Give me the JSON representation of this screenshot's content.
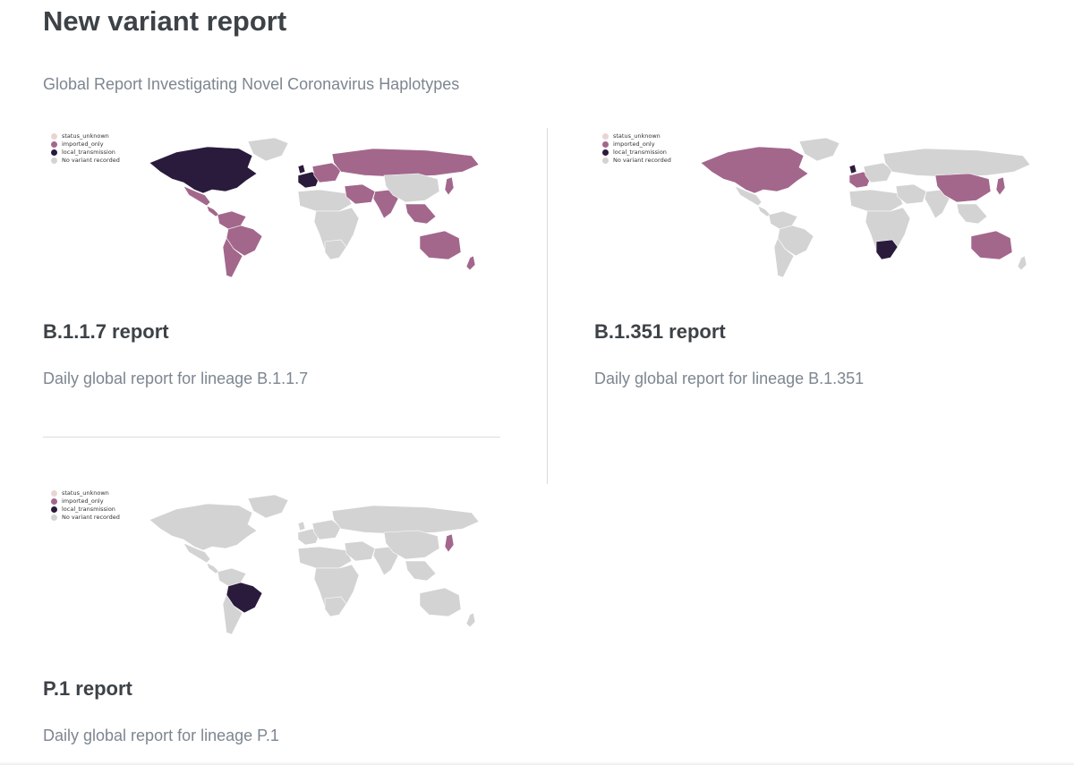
{
  "page": {
    "title": "New variant report",
    "subtitle": "Global Report Investigating Novel Coronavirus Haplotypes"
  },
  "legend": {
    "items": [
      {
        "label": "status_unknown",
        "color": "#e8d5d1"
      },
      {
        "label": "imported_only",
        "color": "#a3678c"
      },
      {
        "label": "local_transmission",
        "color": "#2a1b3d"
      },
      {
        "label": "No variant recorded",
        "color": "#d3d3d3"
      }
    ]
  },
  "colors": {
    "none": "#d3d3d3",
    "imported": "#a3678c",
    "local": "#2a1b3d"
  },
  "reports": [
    {
      "title": "B.1.1.7 report",
      "description": "Daily global report for lineage B.1.1.7",
      "map_status": {
        "north_america": "local",
        "greenland": "none",
        "mexico": "imported",
        "central_america": "imported",
        "south_america_north": "imported",
        "brazil": "imported",
        "argentina_chile": "imported",
        "uk": "local",
        "western_europe": "local",
        "eastern_europe": "imported",
        "russia": "imported",
        "north_africa": "none",
        "africa": "none",
        "middle_east": "imported",
        "india": "imported",
        "china": "none",
        "japan": "imported",
        "southeast_asia": "imported",
        "australia": "imported",
        "new_zealand": "imported"
      }
    },
    {
      "title": "B.1.351 report",
      "description": "Daily global report for lineage B.1.351",
      "map_status": {
        "north_america": "imported",
        "greenland": "none",
        "mexico": "none",
        "central_america": "none",
        "south_america_north": "none",
        "brazil": "none",
        "argentina_chile": "none",
        "uk": "local",
        "western_europe": "imported",
        "eastern_europe": "none",
        "russia": "none",
        "north_africa": "none",
        "africa": "none",
        "southern_africa": "local",
        "middle_east": "none",
        "india": "none",
        "china": "imported",
        "japan": "imported",
        "southeast_asia": "none",
        "australia": "imported",
        "new_zealand": "none"
      }
    },
    {
      "title": "P.1 report",
      "description": "Daily global report for lineage P.1",
      "map_status": {
        "north_america": "none",
        "greenland": "none",
        "mexico": "none",
        "central_america": "none",
        "south_america_north": "none",
        "brazil": "local",
        "argentina_chile": "none",
        "uk": "none",
        "western_europe": "none",
        "eastern_europe": "none",
        "russia": "none",
        "north_africa": "none",
        "africa": "none",
        "middle_east": "none",
        "india": "none",
        "china": "none",
        "japan": "imported",
        "southeast_asia": "none",
        "australia": "none",
        "new_zealand": "none"
      }
    }
  ]
}
